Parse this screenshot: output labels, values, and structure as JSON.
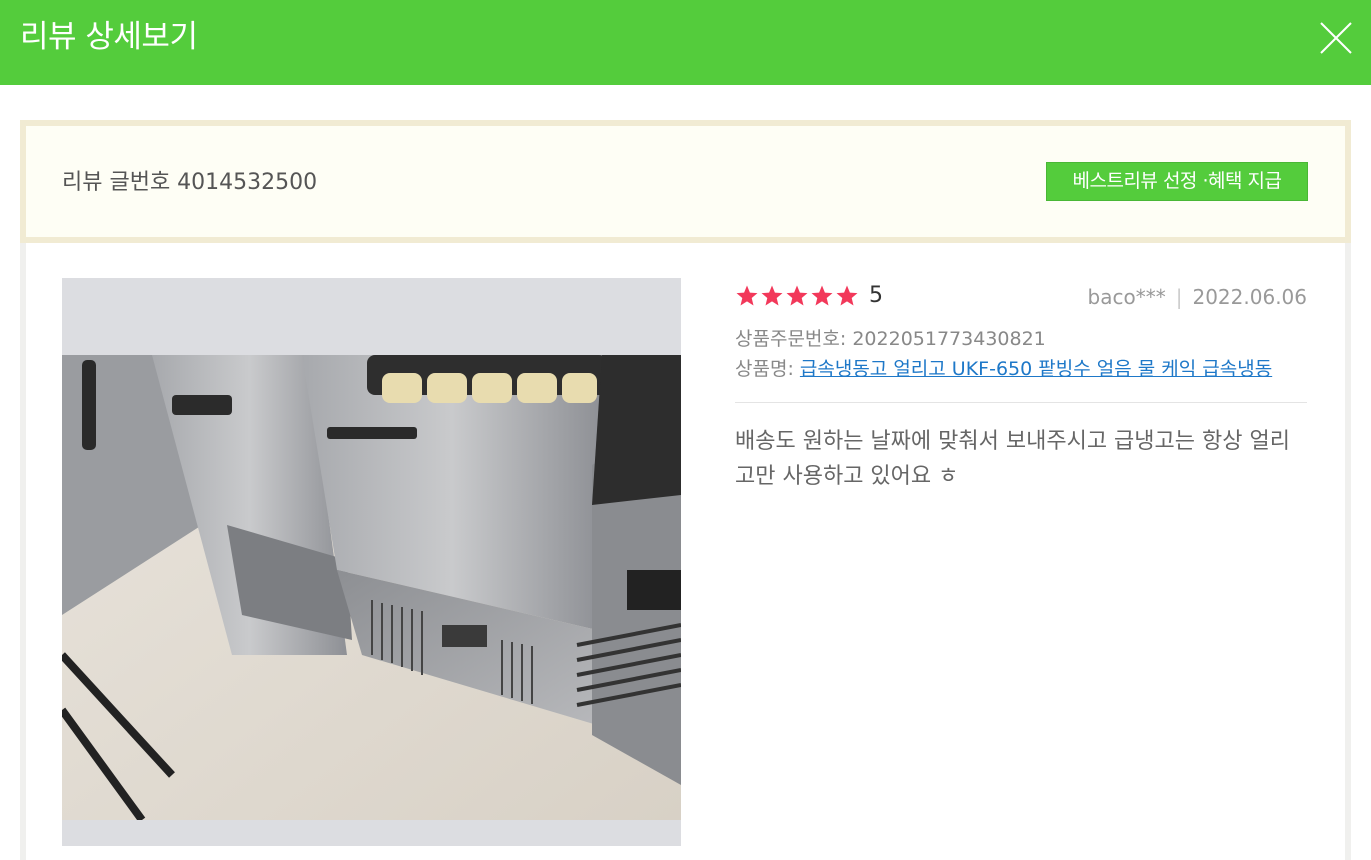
{
  "header": {
    "title": "리뷰 상세보기"
  },
  "review": {
    "number_label": "리뷰 글번호 4014532500",
    "best_button": "베스트리뷰 선정 ·혜택 지급",
    "rating": "5",
    "stars": 5,
    "user": "baco***",
    "date": "2022.06.06",
    "order_label": "상품주문번호:",
    "order_number": "2022051773430821",
    "product_label": "상품명:",
    "product_name": "급속냉동고 얼리고 UKF-650 팥빙수 얼음 물 케익 급속냉동",
    "content": "배송도 원하는 날짜에 맞춰서 보내주시고 급냉고는 항상 얼리고만 사용하고 있어요 ㅎ"
  },
  "colors": {
    "header_bg": "#54cc3c",
    "star": "#f2385a",
    "link": "#1e78c8"
  },
  "icons": {
    "close": "close-icon",
    "star": "star-icon"
  }
}
